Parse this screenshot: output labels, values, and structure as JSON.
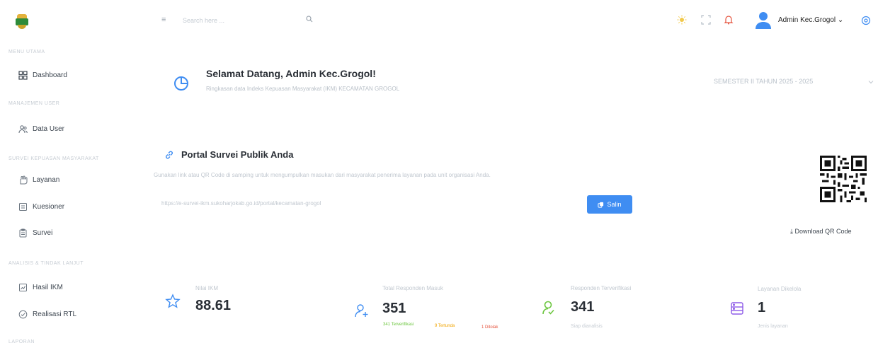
{
  "header": {
    "search_placeholder": "Search here ...",
    "user_name": "Admin Kec.Grogol ⌄"
  },
  "sidebar": {
    "sections": [
      {
        "label": "MENU UTAMA"
      },
      {
        "label": "MANAJEMEN USER"
      },
      {
        "label": "SURVEI KEPUASAN MASYARAKAT"
      },
      {
        "label": "ANALISIS & TINDAK LANJUT"
      },
      {
        "label": "LAPORAN"
      }
    ],
    "items": [
      {
        "label": "Dashboard"
      },
      {
        "label": "Data User"
      },
      {
        "label": "Layanan"
      },
      {
        "label": "Kuesioner"
      },
      {
        "label": "Survei"
      },
      {
        "label": "Hasil IKM"
      },
      {
        "label": "Realisasi RTL"
      }
    ]
  },
  "welcome": {
    "title": "Selamat Datang, Admin Kec.Grogol!",
    "subtitle": "Ringkasan data Indeks Kepuasan Masyarakat (IKM) KECAMATAN GROGOL",
    "semester": "SEMESTER II TAHUN 2025 - 2025"
  },
  "portal": {
    "title": "Portal Survei Publik Anda",
    "description": "Gunakan link atau QR Code di samping untuk mengumpulkan masukan dari masyarakat penerima layanan pada unit organisasi Anda.",
    "url": "https://e-survei-ikm.sukoharjokab.go.id/portal/kecamatan-grogol",
    "copy_label": "Salin",
    "download_label": "Download QR Code"
  },
  "stats": [
    {
      "label": "Nilai IKM",
      "value": "88.61"
    },
    {
      "label": "Total Responden Masuk",
      "value": "351",
      "badges": [
        {
          "text": "341 Terverifikasi"
        },
        {
          "text": "9 Tertunda"
        },
        {
          "text": "1 Ditolak"
        }
      ]
    },
    {
      "label": "Responden Terverifikasi",
      "value": "341",
      "foot": "Siap dianalisis"
    },
    {
      "label": "Layanan Dikelola",
      "value": "1",
      "foot": "Jenis layanan"
    }
  ],
  "colors": {
    "primary": "#3f8df2",
    "green": "#6cc63f",
    "orange": "#f0a400",
    "red": "#e5533d",
    "purple": "#8e5be8"
  }
}
